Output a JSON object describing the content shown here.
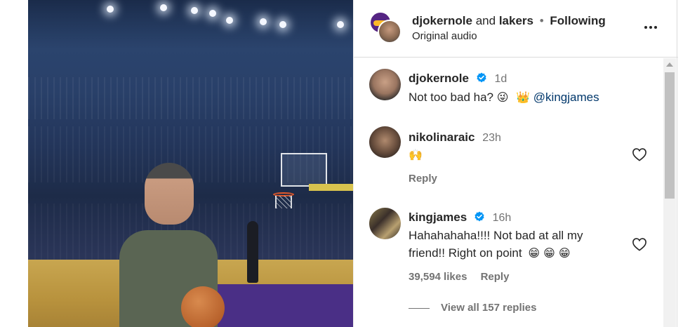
{
  "header": {
    "user": "djokernole",
    "and_text": "and",
    "collab_user": "lakers",
    "separator": "•",
    "follow_status": "Following",
    "audio": "Original audio"
  },
  "comments": [
    {
      "user": "djokernole",
      "verified": true,
      "time": "1d",
      "text": "Not too bad ha?",
      "emoji": "😜",
      "emoji2": "👑",
      "mention": "@kingjames"
    },
    {
      "user": "nikolinaraic",
      "verified": false,
      "time": "23h",
      "text": "🙌",
      "reply": "Reply"
    },
    {
      "user": "kingjames",
      "verified": true,
      "time": "16h",
      "text_line1": "Hahahahaha!!!! Not bad at all my",
      "text_line2": "friend!! Right on point",
      "emoji": "😁 😁 😁",
      "likes": "39,594 likes",
      "reply": "Reply",
      "view_replies": "View all 157 replies"
    }
  ],
  "colors": {
    "text": "#262626",
    "secondary": "#737373",
    "mention": "#00376b",
    "verified": "#0095f6",
    "lakers_purple": "#552583",
    "lakers_gold": "#fdb927"
  },
  "icons": {
    "more": "more-options-icon",
    "heart": "heart-icon",
    "verified": "verified-badge-icon"
  }
}
